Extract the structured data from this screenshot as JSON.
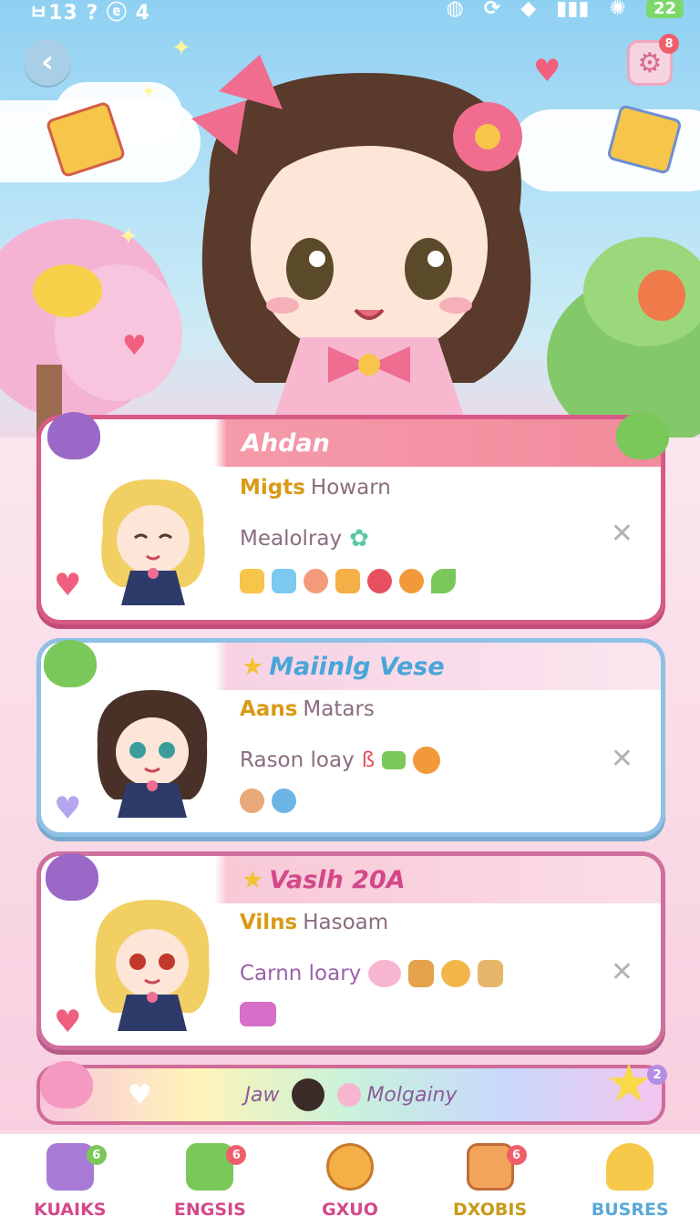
{
  "status_bar": {
    "time": "ㅂ13 ?  ⓔ 4",
    "battery": "22"
  },
  "header": {
    "settings_badge": "8"
  },
  "cards": [
    {
      "title": "Ahdan",
      "row1_key": "Migts",
      "row1_value": "Howarn",
      "row2": "Mealolray"
    },
    {
      "title": "Maiinlg Vese",
      "row1_key": "Aans",
      "row1_value": "Matars",
      "row2": "Rason loay"
    },
    {
      "title": "Vaslh 20A",
      "row1_key": "Vilns",
      "row1_value": "Hasoam",
      "row2": "Carnn loary"
    }
  ],
  "banner": {
    "left": "Jaw",
    "right": "Molgainy",
    "badge": "2"
  },
  "tabs": [
    {
      "label": "KUAIKS",
      "badge": "6",
      "color": "#d4488a"
    },
    {
      "label": "ENGSIS",
      "badge": "6",
      "color": "#d4488a"
    },
    {
      "label": "GXUO",
      "badge": "",
      "color": "#d4488a"
    },
    {
      "label": "DXOBIS",
      "badge": "6",
      "color": "#c79a18"
    },
    {
      "label": "BUSRES",
      "badge": "",
      "color": "#5aa9d8"
    }
  ],
  "colors": {
    "card1_border": "#d75b86",
    "card2_border": "#8fc0e6",
    "card3_border": "#cf6f9c",
    "accent_pink": "#f08bb0"
  },
  "icons": {
    "back": "chevron-left-icon",
    "settings": "gear-icon",
    "close": "close-icon",
    "heart": "heart-icon"
  }
}
